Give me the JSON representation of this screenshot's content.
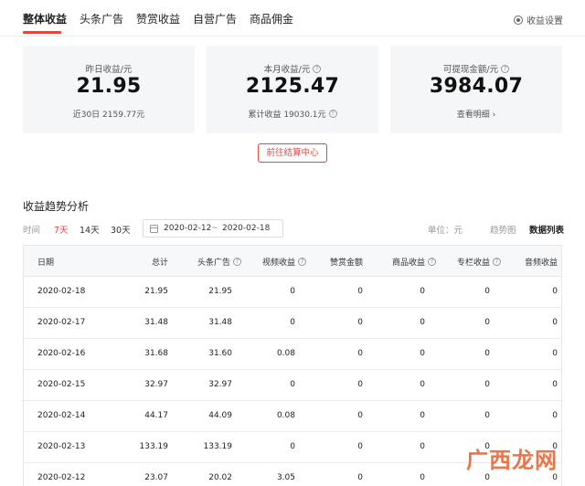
{
  "tabs": [
    {
      "label": "整体收益",
      "active": true
    },
    {
      "label": "头条广告",
      "active": false
    },
    {
      "label": "赞赏收益",
      "active": false
    },
    {
      "label": "自营广告",
      "active": false
    },
    {
      "label": "商品佣金",
      "active": false
    }
  ],
  "settings": {
    "label": "收益设置",
    "icon": "gear-icon"
  },
  "cards": [
    {
      "label": "昨日收益/元",
      "value": "21.95",
      "sub": "近30日 2159.77元"
    },
    {
      "label": "本月收益/元",
      "value": "2125.47",
      "sub": "累计收益 19030.1元"
    },
    {
      "label": "可提现金额/元",
      "value": "3984.07",
      "sub": "查看明细 ›"
    }
  ],
  "settle_button": "前往结算中心",
  "trend": {
    "title": "收益趋势分析",
    "time_label": "时间",
    "ranges": [
      {
        "label": "7天",
        "active": true
      },
      {
        "label": "14天",
        "active": false
      },
      {
        "label": "30天",
        "active": false
      }
    ],
    "date_start": "2020-02-12",
    "date_sep": "~",
    "date_end": "2020-02-18",
    "unit": "单位：元",
    "view_trend": "趋势图",
    "view_list": "数据列表"
  },
  "table": {
    "headers": [
      "日期",
      "总计",
      "头条广告",
      "视频收益",
      "赞赏金额",
      "商品收益",
      "专栏收益",
      "音频收益"
    ],
    "rows": [
      [
        "2020-02-18",
        "21.95",
        "21.95",
        "0",
        "0",
        "0",
        "0",
        "0"
      ],
      [
        "2020-02-17",
        "31.48",
        "31.48",
        "0",
        "0",
        "0",
        "0",
        "0"
      ],
      [
        "2020-02-16",
        "31.68",
        "31.60",
        "0.08",
        "0",
        "0",
        "0",
        "0"
      ],
      [
        "2020-02-15",
        "32.97",
        "32.97",
        "0",
        "0",
        "0",
        "0",
        "0"
      ],
      [
        "2020-02-14",
        "44.17",
        "44.09",
        "0.08",
        "0",
        "0",
        "0",
        "0"
      ],
      [
        "2020-02-13",
        "133.19",
        "133.19",
        "0",
        "0",
        "0",
        "0",
        "0"
      ],
      [
        "2020-02-12",
        "23.07",
        "20.02",
        "3.05",
        "0",
        "0",
        "0",
        "0"
      ]
    ]
  },
  "watermark": "广西龙网",
  "colors": {
    "accent": "#e9443c",
    "card_bg": "#f5f6f7",
    "header_bg": "#f7f8fa"
  }
}
